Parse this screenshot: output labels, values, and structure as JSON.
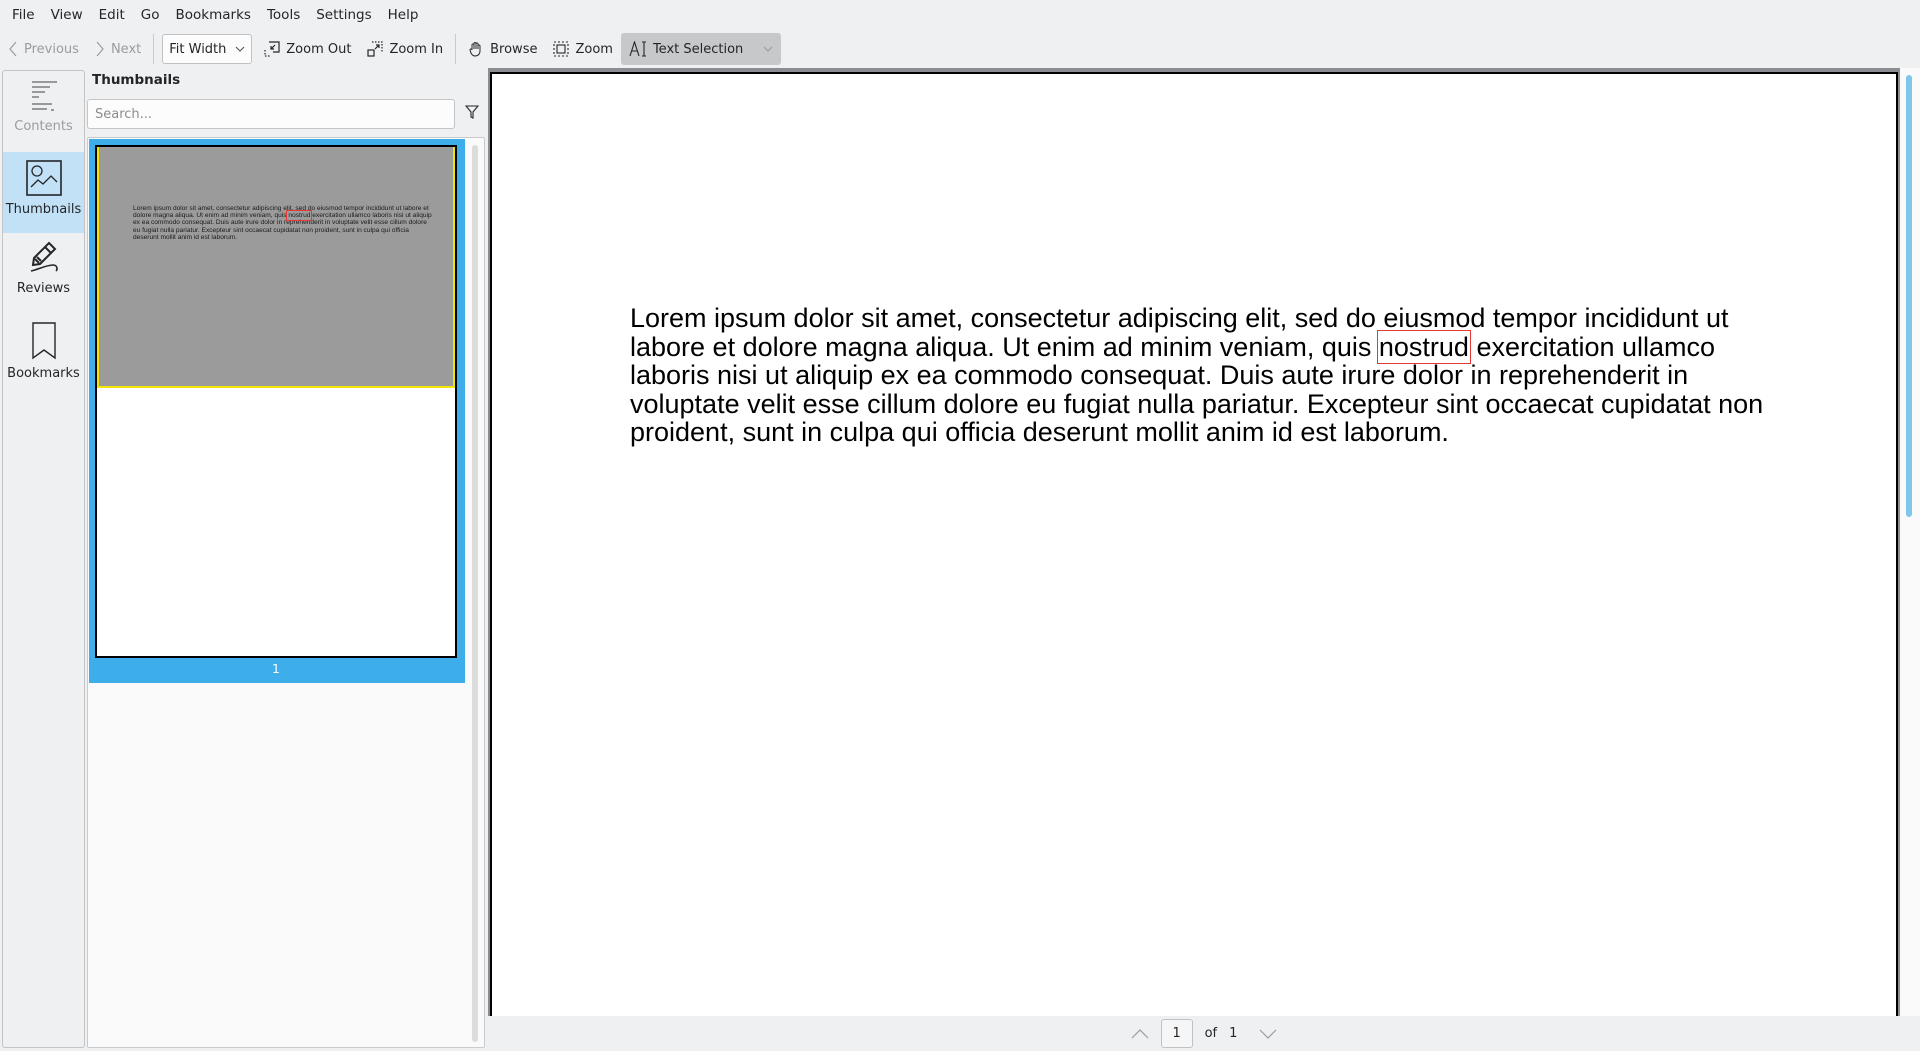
{
  "menu": [
    "File",
    "View",
    "Edit",
    "Go",
    "Bookmarks",
    "Tools",
    "Settings",
    "Help"
  ],
  "toolbar": {
    "previous": "Previous",
    "next": "Next",
    "zoom_mode": "Fit Width",
    "zoom_out": "Zoom Out",
    "zoom_in": "Zoom In",
    "browse": "Browse",
    "zoom": "Zoom",
    "text_selection": "Text Selection"
  },
  "sidebar": {
    "items": [
      {
        "label": "Contents",
        "icon": "contents-icon"
      },
      {
        "label": "Thumbnails",
        "icon": "thumbnails-icon",
        "selected": true
      },
      {
        "label": "Reviews",
        "icon": "reviews-icon"
      },
      {
        "label": "Bookmarks",
        "icon": "bookmarks-icon"
      }
    ]
  },
  "panel": {
    "title": "Thumbnails",
    "search_placeholder": "Search...",
    "thumbnail_page_label": "1"
  },
  "document": {
    "text_before": "Lorem ipsum dolor sit amet, consectetur adipiscing elit, sed do eiusmod tempor incididunt ut labore et dolore magna aliqua. Ut enim ad minim veniam, quis ",
    "highlighted_word": "nostrud",
    "text_after": " exercitation ullamco laboris nisi ut aliquip ex ea commodo consequat. Duis aute irure dolor in reprehenderit in voluptate velit esse cillum dolore eu fugiat nulla pariatur. Excepteur sint occaecat cupidatat non proident, sunt in culpa qui officia deserunt mollit anim id est laborum."
  },
  "pagination": {
    "current": "1",
    "of_label": "of",
    "total": "1"
  },
  "colors": {
    "accent": "#3daee9",
    "selected_sidebar": "#c3e1f6",
    "highlight_box": "#e53935"
  }
}
